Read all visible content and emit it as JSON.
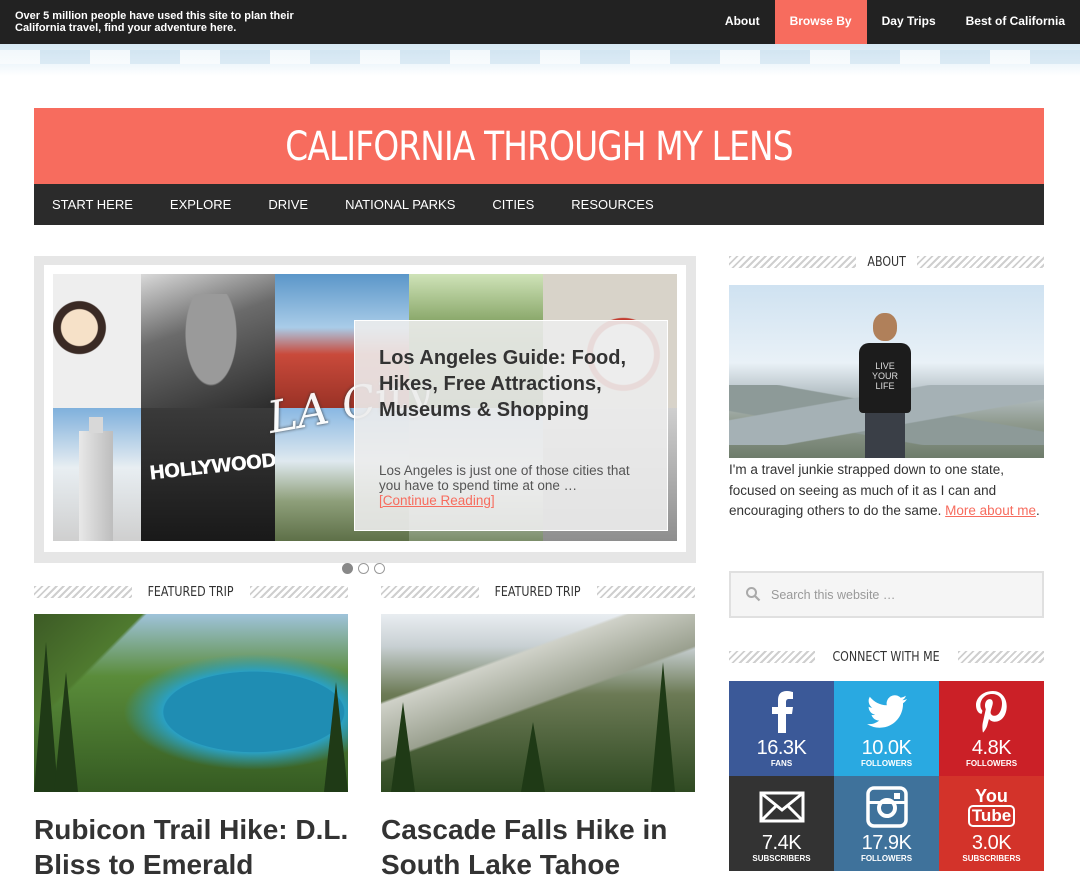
{
  "topbar": {
    "tagline": "Over 5 million people have used this site to plan their California travel, find your adventure here.",
    "nav": [
      "About",
      "Browse By",
      "Day Trips",
      "Best of California"
    ],
    "active": "Browse By"
  },
  "header": {
    "title": "CALIFORNIA THROUGH MY LENS"
  },
  "mainnav": [
    "START HERE",
    "EXPLORE",
    "DRIVE",
    "NATIONAL PARKS",
    "CITIES",
    "RESOURCES"
  ],
  "slider": {
    "overlay_words": {
      "hollywood": "HOLLYWOOD",
      "la": "LA City"
    },
    "title": "Los Angeles Guide: Food, Hikes, Free Attractions, Museums & Shopping",
    "excerpt": "Los Angeles is just one of those cities that you have to spend time at one …",
    "link": "[Continue Reading]",
    "dots": 3,
    "active_dot": 1
  },
  "featured": {
    "label": "FEATURED TRIP",
    "trips": [
      {
        "title": "Rubicon Trail Hike: D.L. Bliss to Emerald"
      },
      {
        "title": "Cascade Falls Hike in South Lake Tahoe"
      }
    ]
  },
  "sidebar": {
    "about_label": "ABOUT",
    "shirt_text": "LIVE YOUR LIFE",
    "about_text": "I'm a travel junkie strapped down to one state, focused on seeing as much of it as I can and encouraging others to do the same.",
    "about_link": "More about me",
    "about_end": ".",
    "search_placeholder": "Search this website …",
    "connect_label": "CONNECT WITH ME",
    "social": [
      {
        "icon": "facebook-icon",
        "count": "16.3K",
        "unit": "FANS"
      },
      {
        "icon": "twitter-icon",
        "count": "10.0K",
        "unit": "FOLLOWERS"
      },
      {
        "icon": "pinterest-icon",
        "count": "4.8K",
        "unit": "FOLLOWERS"
      },
      {
        "icon": "mail-icon",
        "count": "7.4K",
        "unit": "SUBSCRIBERS"
      },
      {
        "icon": "instagram-icon",
        "count": "17.9K",
        "unit": "FOLLOWERS"
      },
      {
        "icon": "youtube-icon",
        "count": "3.0K",
        "unit": "SUBSCRIBERS"
      }
    ],
    "youtube_you": "You",
    "youtube_tube": "Tube"
  },
  "colors": {
    "accent": "#f76c5e",
    "dark": "#2b2b2b"
  }
}
